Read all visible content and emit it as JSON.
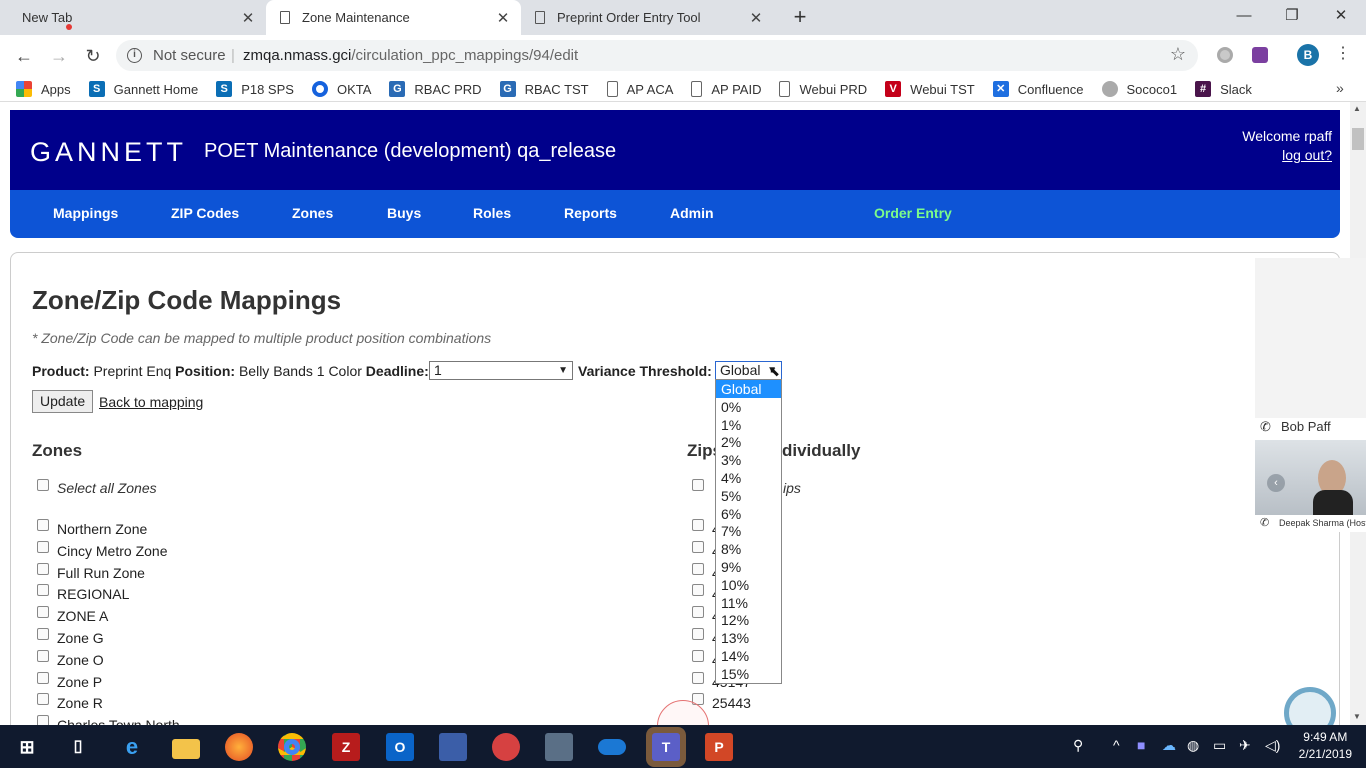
{
  "browser": {
    "tabs": [
      {
        "title": "New Tab"
      },
      {
        "title": "Zone Maintenance"
      },
      {
        "title": "Preprint Order Entry Tool"
      }
    ],
    "address": {
      "security": "Not secure",
      "host": "zmqa.nmass.gci",
      "path": "/circulation_ppc_mappings/94/edit"
    },
    "profile_initial": "B",
    "bookmarks": [
      {
        "label": "Apps",
        "icon": "apps-grid-icon"
      },
      {
        "label": "Gannett Home",
        "icon": "sharepoint-icon"
      },
      {
        "label": "P18 SPS",
        "icon": "sharepoint-icon"
      },
      {
        "label": "OKTA",
        "icon": "okta-icon"
      },
      {
        "label": "RBAC PRD",
        "icon": "g-icon"
      },
      {
        "label": "RBAC TST",
        "icon": "g-icon"
      },
      {
        "label": "AP ACA",
        "icon": "page-icon"
      },
      {
        "label": "AP PAID",
        "icon": "page-icon"
      },
      {
        "label": "Webui PRD",
        "icon": "page-icon"
      },
      {
        "label": "Webui TST",
        "icon": "v-icon"
      },
      {
        "label": "Confluence",
        "icon": "confluence-icon"
      },
      {
        "label": "Sococo1",
        "icon": "sococo-icon"
      },
      {
        "label": "Slack",
        "icon": "slack-icon"
      }
    ]
  },
  "app": {
    "logo": "GANNETT",
    "title": "POET Maintenance (development) qa_release",
    "welcome": "Welcome rpaff",
    "logout": "log out?",
    "nav": [
      "Mappings",
      "ZIP Codes",
      "Zones",
      "Buys",
      "Roles",
      "Reports",
      "Admin",
      "Order Entry"
    ]
  },
  "page": {
    "heading": "Zone/Zip Code Mappings",
    "note": "* Zone/Zip Code can be mapped to multiple product position combinations",
    "product_label": "Product:",
    "product_value": "Preprint Enq",
    "position_label": "Position:",
    "position_value": "Belly Bands 1 Color",
    "deadline_label": "Deadline:",
    "deadline_value": "1",
    "variance_label": "Variance Threshold:",
    "variance_value": "Global",
    "update_button": "Update",
    "back_link": "Back to mapping",
    "zones_heading": "Zones",
    "zips_heading_start": "Zips",
    "zips_heading_end": "dividually",
    "select_all_zones": "Select all Zones",
    "select_all_zips_tail": "ips",
    "zones": [
      "Northern Zone",
      "Cincy Metro Zone",
      "Full Run Zone",
      "REGIONAL",
      "ZONE A",
      "Zone G",
      "Zone O",
      "Zone P",
      "Zone R",
      "Charles Town North"
    ],
    "zip_fragments": [
      "4",
      "4",
      "4",
      "4",
      "4",
      "4",
      "4",
      "45147",
      "25443"
    ],
    "variance_options": [
      "Global",
      "0%",
      "1%",
      "2%",
      "3%",
      "4%",
      "5%",
      "6%",
      "7%",
      "8%",
      "9%",
      "10%",
      "11%",
      "12%",
      "13%",
      "14%",
      "15%"
    ]
  },
  "call": {
    "caller": "Bob Paff",
    "host": "Deepak Sharma (Host)"
  },
  "taskbar": {
    "time": "9:49 AM",
    "date": "2/21/2019"
  },
  "colors": {
    "header_bg": "#00008b",
    "nav_bg": "#0d54d6",
    "order_entry": "#7cfc8a",
    "selected_option": "#1e90ff"
  }
}
